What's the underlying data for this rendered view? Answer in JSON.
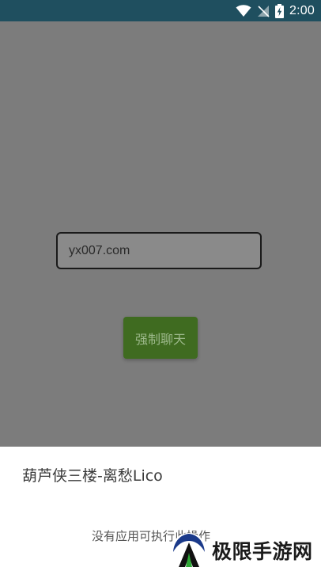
{
  "status_bar": {
    "time": "2:00",
    "icons": [
      "wifi-icon",
      "signal-icon",
      "battery-charging-icon"
    ]
  },
  "main": {
    "input_value": "yx007.com",
    "chat_button_label": "强制聊天"
  },
  "sheet": {
    "title": "葫芦侠三楼-离愁Lico",
    "message": "没有应用可执行此操作"
  },
  "watermark": {
    "text": "极限手游网"
  },
  "colors": {
    "status_bar_bg": "#1f4f5f",
    "dim_overlay": "#7c7c7c",
    "button_bg": "#3f6b20"
  }
}
